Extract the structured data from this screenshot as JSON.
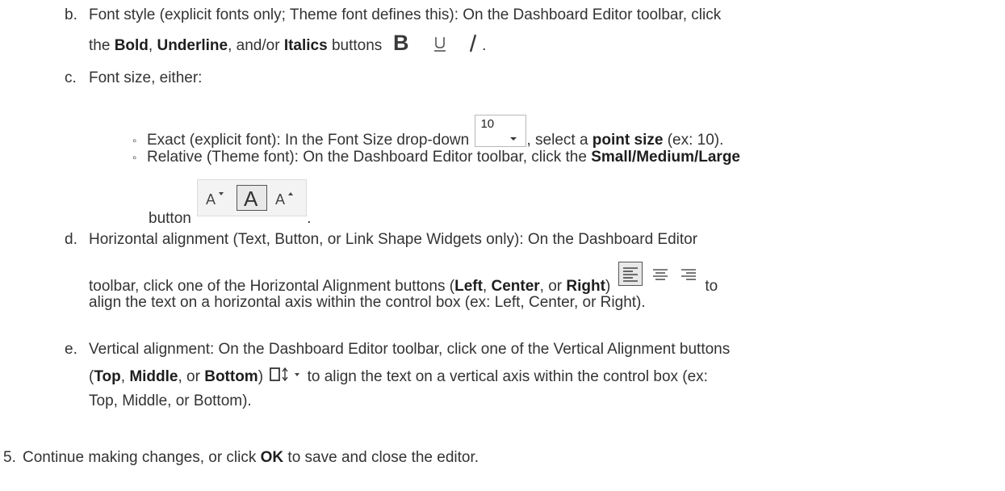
{
  "items": {
    "b": {
      "marker": "b.",
      "t1": "Font style (explicit fonts only; Theme font defines this): On the Dashboard Editor toolbar, click",
      "t2": "the ",
      "bold": "Bold",
      "sep1": ", ",
      "underline": "Underline",
      "sep2": ", and/or ",
      "italics": "Italics",
      "t3": " buttons",
      "end": "."
    },
    "c": {
      "marker": "c.",
      "text": "Font size, either:",
      "exact": {
        "bullet": "◦",
        "t1": "Exact (explicit font): In the Font Size drop-down",
        "t2": ", select a ",
        "bold": "point size",
        "t3": " (ex: 10).",
        "dropdown_value": "10"
      },
      "relative": {
        "bullet": "◦",
        "t1": "Relative (Theme font): On the Dashboard Editor toolbar, click the ",
        "bold": "Small/Medium/Large",
        "t2": "button",
        "end": "."
      }
    },
    "d": {
      "marker": "d.",
      "t1": "Horizontal alignment (Text, Button, or Link Shape Widgets only): On the Dashboard Editor",
      "t2": "toolbar, click one of the Horizontal Alignment buttons (",
      "left": "Left",
      "sep1": ", ",
      "center": "Center",
      "sep2": ", or ",
      "right": "Right",
      "t3": ")",
      "t4": " to",
      "t5": "align the text on a horizontal axis within the control box (ex: Left, Center, or Right)."
    },
    "e": {
      "marker": "e.",
      "t1": "Vertical alignment: On the Dashboard Editor toolbar, click one of the Vertical Alignment buttons",
      "open": "(",
      "top": "Top",
      "sep1": ", ",
      "middle": "Middle",
      "sep2": ", or ",
      "bottom": "Bottom",
      "t2": ")",
      "t3": " to align the text on a vertical axis within the control box (ex:",
      "t4": "Top, Middle, or Bottom)."
    }
  },
  "step5": {
    "marker": "5.",
    "t1": "Continue making changes, or click ",
    "ok": "OK",
    "t2": " to save and close the editor."
  },
  "icons": {
    "bold": "bold-icon",
    "underline": "underline-icon",
    "italic": "italic-icon",
    "font_size_dropdown": "font-size-dropdown",
    "decrease_font": "font-size-small-icon",
    "medium_font": "font-size-medium-icon",
    "increase_font": "font-size-large-icon",
    "align_left": "align-left-icon",
    "align_center": "align-center-icon",
    "align_right": "align-right-icon",
    "vertical_align": "vertical-align-icon"
  },
  "colors": {
    "text": "#333333",
    "icon": "#444444",
    "selected_border": "#555555"
  }
}
